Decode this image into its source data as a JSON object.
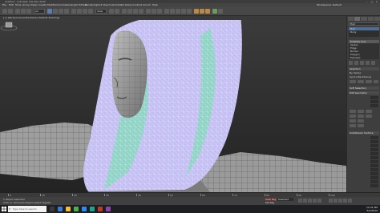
{
  "window": {
    "title": "Untitled - Autodesk 3ds Max 2020",
    "controls": [
      "–",
      "□",
      "×"
    ]
  },
  "menu": [
    "File",
    "Edit",
    "Tools",
    "Group",
    "Views",
    "Create",
    "Modifiers",
    "Animation",
    "Graph Editors",
    "Rendering",
    "Civil View",
    "Customize",
    "Scripting",
    "Content",
    "Arnold",
    "Help"
  ],
  "toolbar": {
    "selection_filter": "All",
    "view_dropdown": "View",
    "workspace": "Workspaces: Default"
  },
  "viewport": {
    "label": "[+] [Perspective] [Standard] [Default Shading]"
  },
  "command_panel": {
    "name_field": "Hair",
    "object_list": [
      "Hair",
      "Body"
    ],
    "modifier_stack": [
      "Editable Poly",
      "Vertex",
      "Edge",
      "Border",
      "Polygon",
      "Element"
    ],
    "rollouts": [
      "Selection",
      "Soft Selection",
      "Edit Geometry",
      "Subdivision Surface"
    ],
    "params": [
      "By Vertex",
      "Ignore Backfacing",
      "Shrink",
      "Grow",
      "Ring",
      "Loop"
    ]
  },
  "timeline": {
    "ticks": [
      "0",
      "10",
      "20",
      "30",
      "40",
      "50",
      "60",
      "70",
      "80",
      "90",
      "100"
    ]
  },
  "status": {
    "line1": "1 Object Selected",
    "line2": "Click or click-and-drag to select objects",
    "auto_key": "Auto Key",
    "set_key": "Set Key",
    "selected": "Selected"
  },
  "taskbar": {
    "search_placeholder": "Type here to search",
    "time": "12:41 PM",
    "date": "5/2/2020"
  },
  "colors": {
    "hair_wire": "#c9c4f5",
    "hair_inner": "#8fd6c8",
    "mesh_gray": "#a8a8a8",
    "accent": "#4f6d93"
  }
}
